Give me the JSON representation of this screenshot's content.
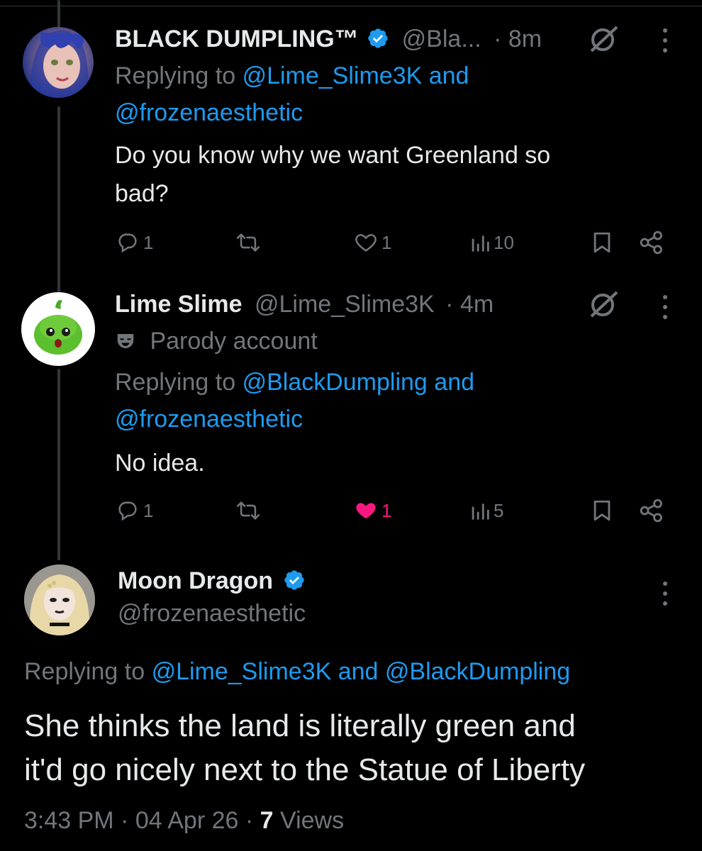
{
  "tweets": [
    {
      "name": "BLACK DUMPLING™",
      "handle": "@Bla...",
      "time": "· 8m",
      "reply_prefix": "Replying to",
      "reply_line1_link": "@Lime_Slime3K and",
      "reply_line2_link": "@frozenaesthetic",
      "text_line1": "Do you know why we want Greenland so",
      "text_line2": "bad?",
      "replies": "1",
      "likes": "1",
      "views": "10",
      "liked": false
    },
    {
      "name": "Lime Slime",
      "handle": "@Lime_Slime3K",
      "time": "· 4m",
      "badge_label": "Parody account",
      "reply_prefix": "Replying to",
      "reply_line1_link": "@BlackDumpling and",
      "reply_line2_link": "@frozenaesthetic",
      "text_line1": "No idea.",
      "replies": "1",
      "likes": "1",
      "views": "5",
      "liked": true
    }
  ],
  "main_tweet": {
    "name": "Moon Dragon",
    "handle": "@frozenaesthetic",
    "reply_prefix": "Replying to",
    "reply_link": "@Lime_Slime3K and @BlackDumpling",
    "text_line1": "She thinks the land is literally green and",
    "text_line2": "it'd go nicely next to the Statue of Liberty",
    "time": "3:43 PM",
    "date": "04 Apr 26",
    "views_count": "7",
    "views_label": "Views"
  },
  "colors": {
    "background": "#000000",
    "text": "#e7e9ea",
    "muted": "#71767b",
    "link": "#1d9bf0",
    "like_active": "#f91880",
    "verified": "#1d9bf0"
  },
  "icons": [
    "verified-badge-icon",
    "grok-icon",
    "more-icon",
    "reply-icon",
    "retweet-icon",
    "like-icon",
    "views-icon",
    "bookmark-icon",
    "share-icon",
    "parody-mask-icon"
  ]
}
